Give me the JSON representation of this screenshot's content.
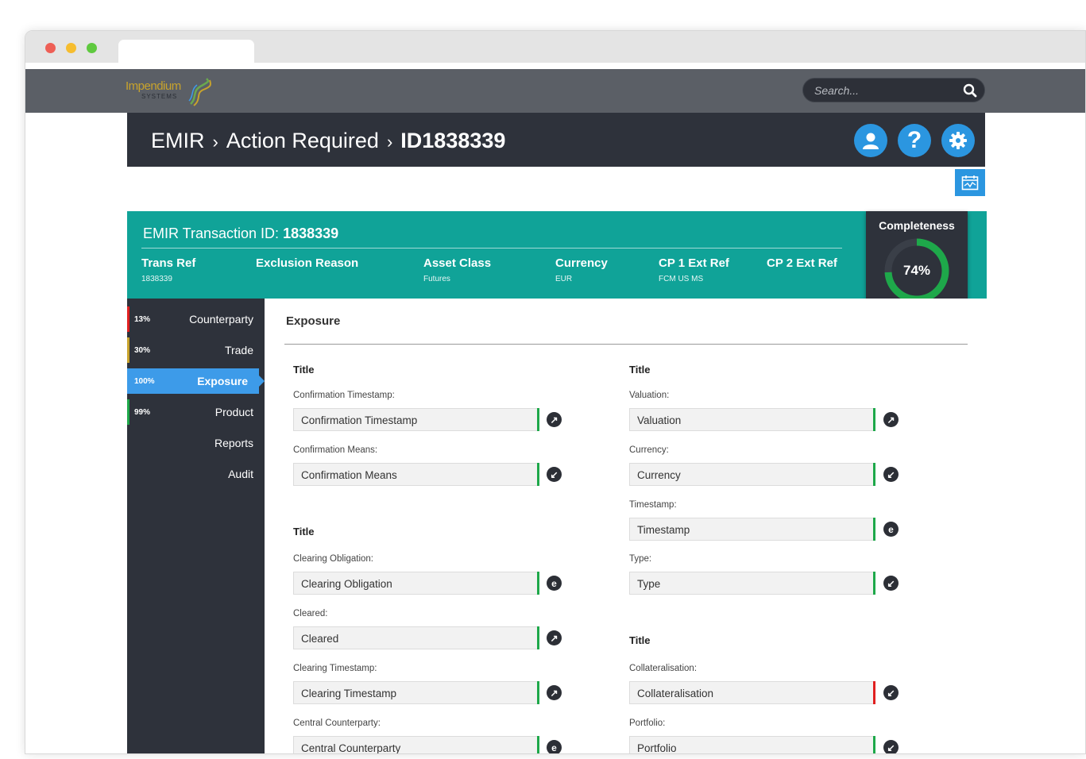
{
  "app": {
    "logo_text": "Impendium",
    "logo_subtext": "SYSTEMS",
    "search_placeholder": "Search...",
    "icons": [
      "search-icon",
      "user-icon",
      "help-icon",
      "gear-icon",
      "calendar-chart-icon"
    ]
  },
  "breadcrumb": {
    "items": [
      "EMIR",
      "Action Required"
    ],
    "current": "ID1838339",
    "separator": "›"
  },
  "header_actions": {
    "help_glyph": "?"
  },
  "transaction": {
    "title_prefix": "EMIR Transaction ID:",
    "id": "1838339",
    "fields": [
      {
        "label": "Trans Ref",
        "value": "1838339"
      },
      {
        "label": "Exclusion Reason",
        "value": ""
      },
      {
        "label": "Asset Class",
        "value": "Futures"
      },
      {
        "label": "Currency",
        "value": "EUR"
      },
      {
        "label": "CP 1 Ext Ref",
        "value": "FCM US MS"
      },
      {
        "label": "CP 2 Ext Ref",
        "value": ""
      }
    ]
  },
  "completeness": {
    "title": "Completeness",
    "value_text": "74%",
    "fraction": 0.74,
    "color": "#1ea84a"
  },
  "sidebar": {
    "items": [
      {
        "pct": "13%",
        "label": "Counterparty",
        "status_color": "#e02020"
      },
      {
        "pct": "30%",
        "label": "Trade",
        "status_color": "#c8a32c"
      },
      {
        "pct": "100%",
        "label": "Exposure",
        "status_color": "#3d9be9",
        "active": true
      },
      {
        "pct": "99%",
        "label": "Product",
        "status_color": "#1ea84a"
      },
      {
        "pct": "",
        "label": "Reports"
      },
      {
        "pct": "",
        "label": "Audit"
      }
    ]
  },
  "main": {
    "section_title": "Exposure",
    "left_groups": [
      {
        "title": "Title",
        "fields": [
          {
            "label": "Confirmation Timestamp:",
            "value": "Confirmation Timestamp",
            "status": "green",
            "action": "↗"
          },
          {
            "label": "Confirmation Means:",
            "value": "Confirmation Means",
            "status": "green",
            "action": "↙"
          }
        ]
      },
      {
        "title": "Title",
        "fields": [
          {
            "label": "Clearing Obligation:",
            "value": "Clearing Obligation",
            "status": "green",
            "action": "e"
          },
          {
            "label": "Cleared:",
            "value": "Cleared",
            "status": "green",
            "action": "↗"
          },
          {
            "label": "Clearing Timestamp:",
            "value": "Clearing Timestamp",
            "status": "green",
            "action": "↗"
          },
          {
            "label": "Central Counterparty:",
            "value": "Central Counterparty",
            "status": "green",
            "action": "e"
          }
        ]
      }
    ],
    "right_groups": [
      {
        "title": "Title",
        "fields": [
          {
            "label": "Valuation:",
            "value": "Valuation",
            "status": "green",
            "action": "↗"
          },
          {
            "label": "Currency:",
            "value": "Currency",
            "status": "green",
            "action": "↙"
          },
          {
            "label": "Timestamp:",
            "value": "Timestamp",
            "status": "green",
            "action": "e"
          },
          {
            "label": "Type:",
            "value": "Type",
            "status": "green",
            "action": "↙"
          }
        ]
      },
      {
        "title": "Title",
        "fields": [
          {
            "label": "Collateralisation:",
            "value": "Collateralisation",
            "status": "red",
            "action": "↙"
          },
          {
            "label": "Portfolio:",
            "value": "Portfolio",
            "status": "green",
            "action": "↙"
          }
        ]
      }
    ]
  }
}
